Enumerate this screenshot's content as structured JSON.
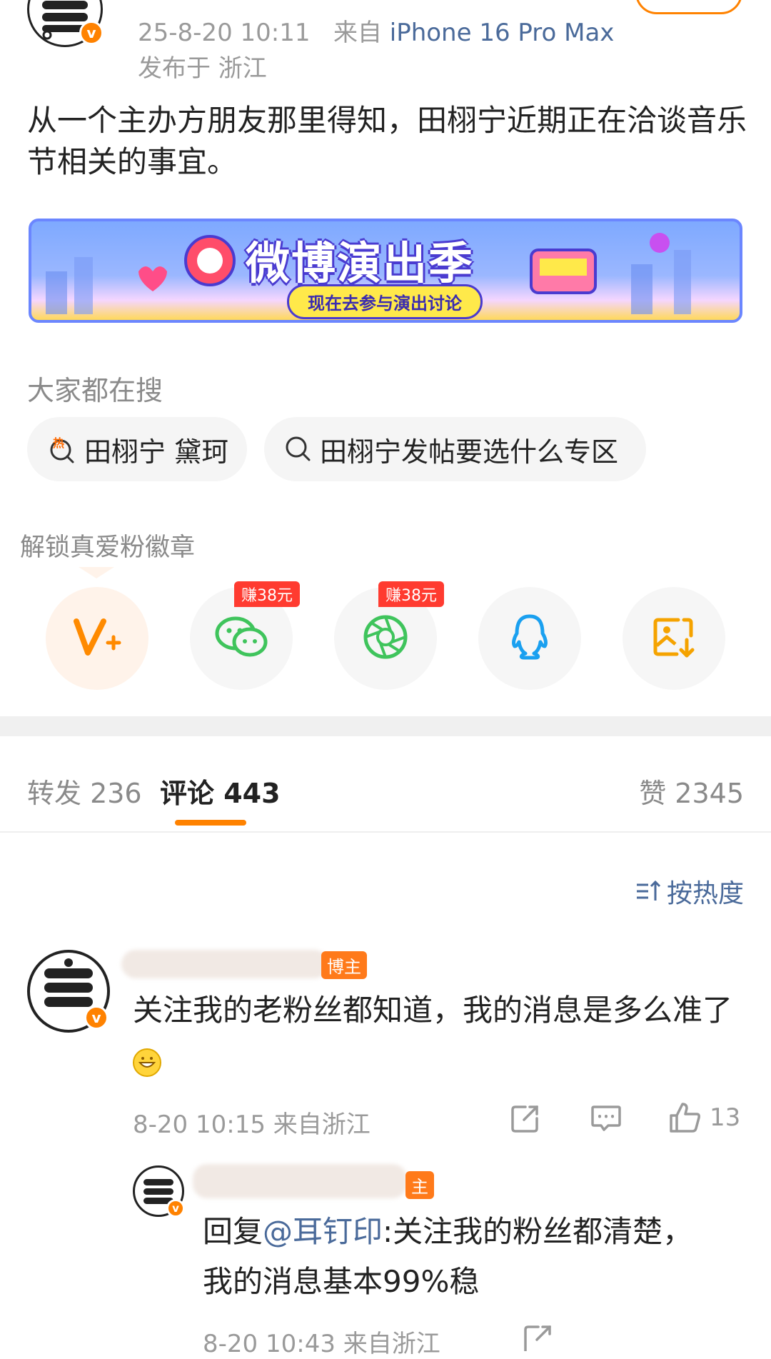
{
  "post": {
    "time": "25-8-20 10:11",
    "from_prefix": "来自",
    "device": "iPhone 16 Pro Max",
    "location": "发布于 浙江",
    "text": "从一个主办方朋友那里得知，田栩宁近期正在洽谈音乐节相关的事宜。",
    "badge_letter": "v"
  },
  "banner": {
    "title": "微博演出季",
    "subtitle": "现在去参与演出讨论"
  },
  "search": {
    "label": "大家都在搜",
    "chips": [
      {
        "text": "田栩宁 黛珂",
        "icon": "hot-search-icon",
        "hot_mark": "热"
      },
      {
        "text": "田栩宁发帖要选什么专区",
        "icon": "search-icon"
      }
    ]
  },
  "share": {
    "label": "解锁真爱粉徽章",
    "items": [
      {
        "name": "vplus-icon"
      },
      {
        "name": "wechat-icon",
        "badge": "赚38元"
      },
      {
        "name": "moments-icon",
        "badge": "赚38元"
      },
      {
        "name": "qq-icon"
      },
      {
        "name": "save-image-icon"
      }
    ]
  },
  "tabs": {
    "repost": "转发 236",
    "comment": "评论 443",
    "like": "赞 2345"
  },
  "sort_label": "按热度",
  "comments": [
    {
      "fan_tag": "博主",
      "text": "关注我的老粉丝都知道，我的消息是多么准了",
      "time_loc": "8-20 10:15 来自浙江",
      "likes": "13"
    }
  ],
  "reply": {
    "fan_tag": "主",
    "prefix": "回复",
    "mention": "@耳钉印",
    "text_line1": ":关注我的粉丝都清楚，",
    "text_line2": "我的消息基本99%稳",
    "time_loc": "8-20 10:43 来自浙江"
  },
  "colors": {
    "accent": "#ff8200",
    "link": "#4a6a9a",
    "wechat": "#3fc45c",
    "qq": "#1aa0f0",
    "save": "#f5a300"
  }
}
